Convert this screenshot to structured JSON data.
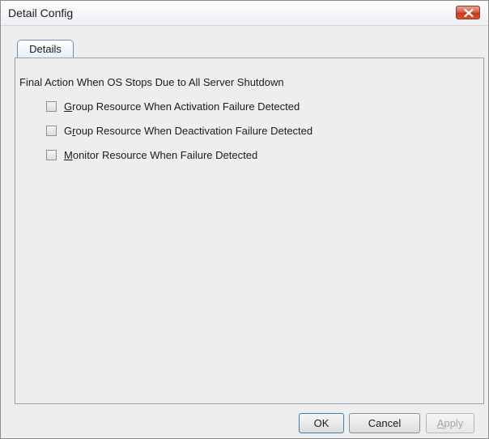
{
  "window": {
    "title": "Detail Config"
  },
  "tabs": [
    {
      "label": "Details",
      "selected": true
    }
  ],
  "details": {
    "section_label": "Final Action When OS Stops Due to All Server Shutdown",
    "options": [
      {
        "mnemonic": "G",
        "rest": "roup Resource When Activation Failure Detected",
        "checked": false
      },
      {
        "prefix": "G",
        "mnemonic": "r",
        "rest": "oup Resource When Deactivation Failure Detected",
        "checked": false
      },
      {
        "mnemonic": "M",
        "rest": "onitor Resource When Failure Detected",
        "checked": false
      }
    ]
  },
  "buttons": {
    "ok": "OK",
    "cancel": "Cancel",
    "apply_mnemonic": "A",
    "apply_rest": "pply",
    "apply_enabled": false
  },
  "colors": {
    "close_button": "#c7361c",
    "default_button_border": "#3c7fb1",
    "disabled_text": "#a6a6a6"
  }
}
